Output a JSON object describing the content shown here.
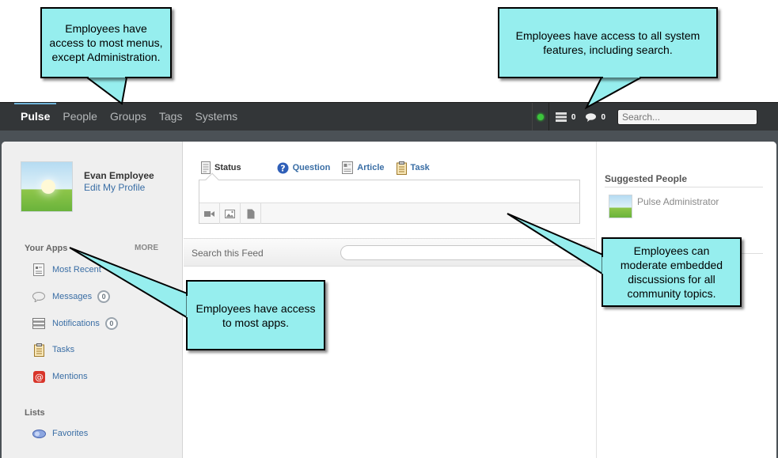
{
  "nav": {
    "items": [
      {
        "label": "Pulse",
        "active": true
      },
      {
        "label": "People",
        "active": false
      },
      {
        "label": "Groups",
        "active": false
      },
      {
        "label": "Tags",
        "active": false
      },
      {
        "label": "Systems",
        "active": false
      }
    ],
    "notifications_count": "0",
    "messages_count": "0",
    "search_placeholder": "Search..."
  },
  "profile": {
    "name": "Evan Employee",
    "edit_label": "Edit My Profile"
  },
  "apps": {
    "title": "Your Apps",
    "more_label": "MORE",
    "items": [
      {
        "label": "Most Recent",
        "icon": "most-recent-icon",
        "count": null
      },
      {
        "label": "Messages",
        "icon": "speech-bubble-icon",
        "count": "0"
      },
      {
        "label": "Notifications",
        "icon": "notifications-icon",
        "count": "0"
      },
      {
        "label": "Tasks",
        "icon": "clipboard-icon",
        "count": null
      },
      {
        "label": "Mentions",
        "icon": "at-sign-icon",
        "count": null
      }
    ]
  },
  "lists": {
    "title": "Lists",
    "items": [
      {
        "label": "Favorites",
        "icon": "favorites-icon"
      }
    ]
  },
  "composer": {
    "tabs": [
      {
        "label": "Status",
        "icon": "status-document-icon",
        "active": true
      },
      {
        "label": "Question",
        "icon": "question-icon",
        "active": false
      },
      {
        "label": "Article",
        "icon": "article-icon",
        "active": false
      },
      {
        "label": "Task",
        "icon": "task-clipboard-icon",
        "active": false
      }
    ],
    "tools": [
      "video-icon",
      "image-icon",
      "file-icon"
    ]
  },
  "feed": {
    "search_label": "Search this Feed"
  },
  "suggested": {
    "title": "Suggested People",
    "people": [
      {
        "name": "Pulse Administrator"
      }
    ]
  },
  "callouts": {
    "menus": "Employees have access to most menus, except Administration.",
    "search": "Employees have access to all system features, including search.",
    "apps": "Employees have access to most apps.",
    "moderate": "Employees can moderate embedded discussions for all community topics."
  },
  "colors": {
    "topbar": "#333638",
    "callout": "#96eeee",
    "link": "#3a6ea5",
    "status_online": "#3cc43c"
  }
}
